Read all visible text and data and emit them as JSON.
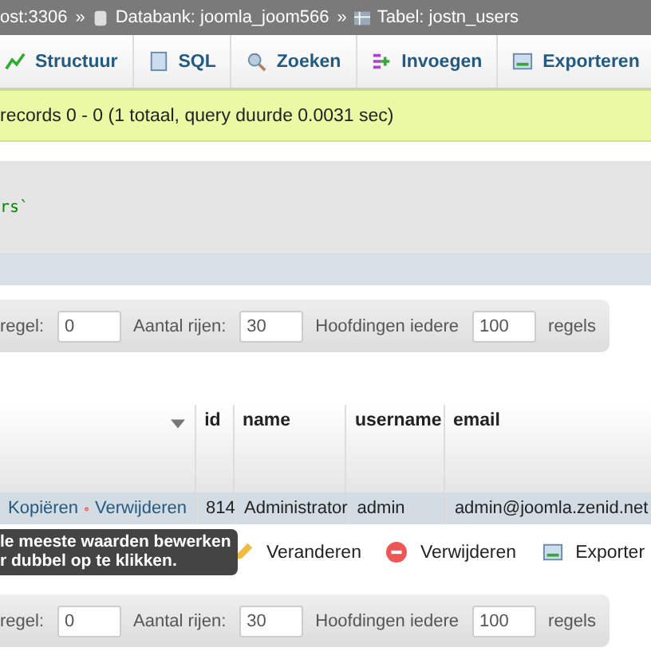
{
  "breadcrumb": [
    {
      "kind": "server",
      "label": "ost:3306"
    },
    {
      "kind": "database",
      "label": "Databank: joomla_joom566"
    },
    {
      "kind": "table",
      "label": "Tabel: jostn_users"
    }
  ],
  "separator": "»",
  "tabs": [
    {
      "kind": "structure",
      "label": "Structuur",
      "selected": false
    },
    {
      "kind": "sql",
      "label": "SQL",
      "selected": false
    },
    {
      "kind": "search",
      "label": "Zoeken",
      "selected": false
    },
    {
      "kind": "insert",
      "label": "Invoegen",
      "selected": false
    },
    {
      "kind": "export",
      "label": "Exporteren",
      "selected": false
    }
  ],
  "message": "records 0 - 0 (1 totaal, query duurde 0.0031 sec)",
  "query_fragment": "rs`",
  "nav_top": {
    "start_label": "regel:",
    "start_value": "0",
    "rows_label": "Aantal rijen:",
    "rows_value": "30",
    "headers_label": "Hoofdingen iedere",
    "headers_value": "100",
    "unit": "regels"
  },
  "table": {
    "columns": [
      "id",
      "name",
      "username",
      "email"
    ],
    "rows": [
      {
        "copy": "Kopiëren",
        "delete": "Verwijderen",
        "cells": [
          "814",
          "Administrator",
          "admin",
          "admin@joomla.zenid.net"
        ]
      }
    ]
  },
  "tooltip": [
    "le meeste waarden bewerken",
    "r dubbel op te klikken."
  ],
  "actions": [
    {
      "kind": "edit",
      "label": "Veranderen"
    },
    {
      "kind": "delete",
      "label": "Verwijderen"
    },
    {
      "kind": "export",
      "label": "Exporter"
    }
  ],
  "nav_bottom": {
    "start_label": "regel:",
    "start_value": "0",
    "rows_label": "Aantal rijen:",
    "rows_value": "30",
    "headers_label": "Hoofdingen iedere",
    "headers_value": "100",
    "unit": "regels"
  }
}
